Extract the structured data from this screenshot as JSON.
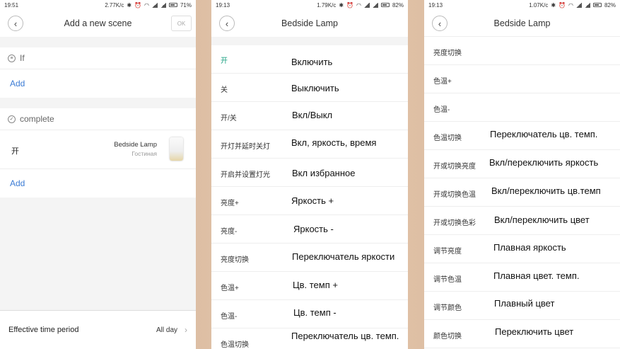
{
  "screen1": {
    "status": {
      "time": "19:51",
      "speed": "2.77K/c",
      "battery": "71%"
    },
    "header": {
      "title": "Add a new scene",
      "ok_label": "OK"
    },
    "if_section": {
      "label": "If",
      "add_label": "Add"
    },
    "complete_section": {
      "label": "complete",
      "add_label": "Add"
    },
    "device": {
      "action": "开",
      "name": "Bedside Lamp",
      "room": "Гостиная"
    },
    "footer": {
      "label": "Effective time period",
      "value": "All day"
    }
  },
  "screen2": {
    "status": {
      "time": "19:13",
      "speed": "1.79K/c",
      "battery": "82%"
    },
    "header": {
      "title": "Bedside Lamp"
    },
    "rows": [
      {
        "cn": "开",
        "ru": "Включить"
      },
      {
        "cn": "关",
        "ru": "Выключить"
      },
      {
        "cn": "开/关",
        "ru": "Вкл/Выкл"
      },
      {
        "cn": "开灯并延时关灯",
        "ru": "Вкл, яркость, время"
      },
      {
        "cn": "开启并设置灯光",
        "ru": "Вкл избранное"
      },
      {
        "cn": "亮度+",
        "ru": "Яркость +"
      },
      {
        "cn": "亮度-",
        "ru": "Яркость -"
      },
      {
        "cn": "亮度切换",
        "ru": "Переключатель яркости"
      },
      {
        "cn": "色温+",
        "ru": "Цв. темп +"
      },
      {
        "cn": "色温-",
        "ru": "Цв. темп -"
      },
      {
        "cn": "色温切换",
        "ru": "Переключатель цв. темп."
      }
    ]
  },
  "screen3": {
    "status": {
      "time": "19:13",
      "speed": "1.07K/c",
      "battery": "82%"
    },
    "header": {
      "title": "Bedside Lamp"
    },
    "rows": [
      {
        "cn": "亮度切换",
        "ru": ""
      },
      {
        "cn": "色温+",
        "ru": ""
      },
      {
        "cn": "色温-",
        "ru": ""
      },
      {
        "cn": "色温切换",
        "ru": "Переключатель цв. темп."
      },
      {
        "cn": "开或切换亮度",
        "ru": "Вкл/переключить яркость"
      },
      {
        "cn": "开或切换色温",
        "ru": "Вкл/переключить цв.темп"
      },
      {
        "cn": "开或切换色彩",
        "ru": "Вкл/переключить цвет"
      },
      {
        "cn": "调节亮度",
        "ru": "Плавная яркость"
      },
      {
        "cn": "调节色温",
        "ru": "Плавная цвет. темп."
      },
      {
        "cn": "调节颜色",
        "ru": "Плавный цвет"
      },
      {
        "cn": "颜色切换",
        "ru": "Переключить цвет"
      }
    ]
  },
  "colors": {
    "accent": "#3b7bd4",
    "green": "#1aa080"
  }
}
